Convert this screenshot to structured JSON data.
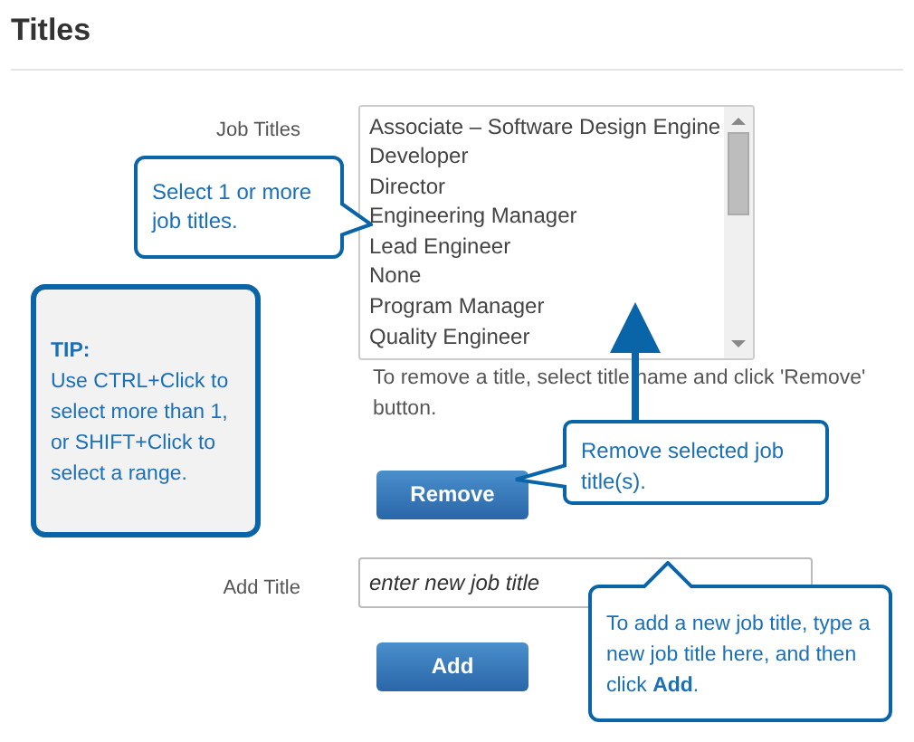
{
  "heading": "Titles",
  "job_titles": {
    "label": "Job Titles",
    "options": [
      {
        "text": "Associate – Software Design Engine",
        "selected": false
      },
      {
        "text": "Developer",
        "selected": false
      },
      {
        "text": "Director",
        "selected": false
      },
      {
        "text": "Engineering Manager",
        "selected": false
      },
      {
        "text": "Lead Engineer",
        "selected": false
      },
      {
        "text": "None",
        "selected": false
      },
      {
        "text": "Program Manager",
        "selected": false
      },
      {
        "text": "Quality Engineer",
        "selected": false
      }
    ],
    "help": "To remove a title, select title name and click 'Remove' button.",
    "button": "Remove"
  },
  "add_title": {
    "label": "Add Title",
    "placeholder": "enter new job title",
    "button": "Add"
  },
  "callouts": [
    {
      "kind": "select",
      "text": "Select 1 or more job titles."
    },
    {
      "kind": "tip",
      "title": "TIP:",
      "text": "Use CTRL+Click to select more than 1, or SHIFT+Click to select a range."
    },
    {
      "kind": "remove",
      "text": "Remove selected job title(s)."
    },
    {
      "kind": "add",
      "text": "To add a new job title, type a new job title here, and then click **Add**."
    }
  ]
}
